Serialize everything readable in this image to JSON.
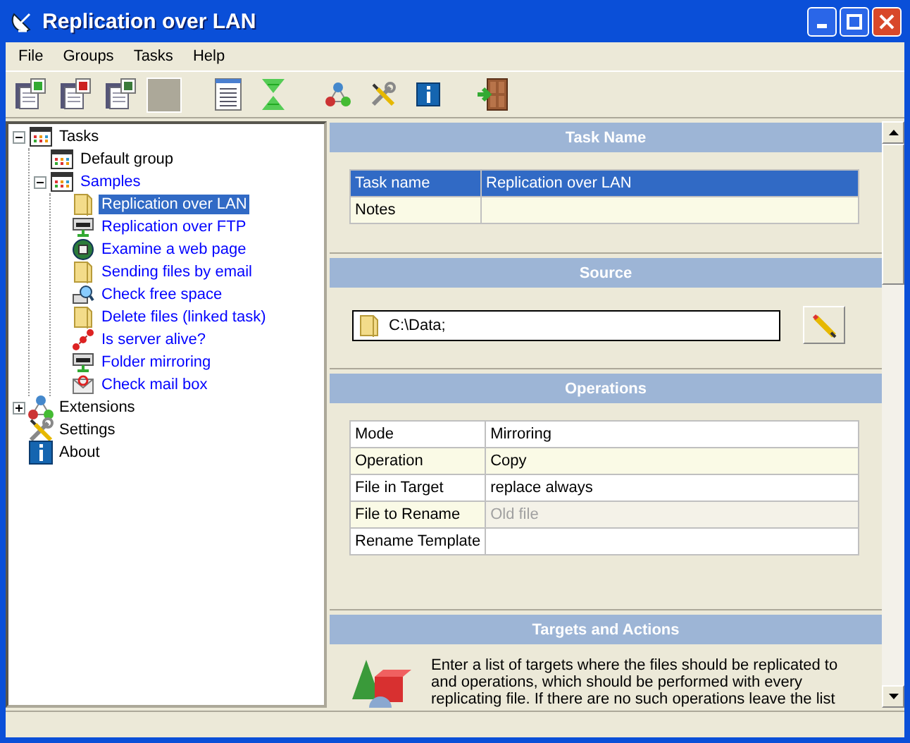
{
  "window": {
    "title": "Replication over LAN"
  },
  "menu": [
    "File",
    "Groups",
    "Tasks",
    "Help"
  ],
  "toolbar": [
    {
      "kind": "add"
    },
    {
      "kind": "remove"
    },
    {
      "kind": "props"
    },
    {
      "kind": "blank"
    },
    {
      "kind": "list"
    },
    {
      "kind": "arrows"
    },
    {
      "kind": "molecule"
    },
    {
      "kind": "tools"
    },
    {
      "kind": "info"
    },
    {
      "kind": "door"
    }
  ],
  "tree": [
    {
      "label": "Tasks",
      "kind": "group",
      "color": "#000000",
      "selected": false,
      "expanded": true,
      "children": [
        {
          "label": "Default group",
          "kind": "group",
          "color": "#000000",
          "selected": false
        },
        {
          "label": "Samples",
          "kind": "group",
          "color": "#0000ff",
          "selected": false,
          "expanded": true,
          "children": [
            {
              "label": "Replication over LAN",
              "kind": "folder",
              "selected": true
            },
            {
              "label": "Replication over FTP",
              "kind": "server",
              "color": "#0000ff",
              "selected": false
            },
            {
              "label": "Examine a web page",
              "kind": "globe",
              "color": "#0000ff",
              "selected": false
            },
            {
              "label": "Sending files by email",
              "kind": "folder",
              "color": "#0000ff",
              "selected": false
            },
            {
              "label": "Check free space",
              "kind": "magnifier",
              "color": "#0000ff",
              "selected": false
            },
            {
              "label": "Delete files (linked task)",
              "kind": "folder",
              "color": "#0000ff",
              "selected": false
            },
            {
              "label": "Is server alive?",
              "kind": "balls",
              "color": "#0000ff",
              "selected": false
            },
            {
              "label": "Folder mirroring",
              "kind": "server",
              "color": "#0000ff",
              "selected": false
            },
            {
              "label": "Check mail box",
              "kind": "envelope",
              "color": "#0000ff",
              "selected": false
            }
          ]
        }
      ]
    },
    {
      "label": "Extensions",
      "kind": "molecule",
      "color": "#000000",
      "selected": false,
      "expanded": false
    },
    {
      "label": "Settings",
      "kind": "tools",
      "color": "#000000",
      "selected": false
    },
    {
      "label": "About",
      "kind": "info",
      "color": "#000000",
      "selected": false
    }
  ],
  "sections": [
    {
      "title": "Task Name",
      "kind": "table",
      "rows": [
        {
          "label": "Task name",
          "value": "Replication over LAN",
          "selected": true
        },
        {
          "label": "Notes",
          "selected": false
        }
      ]
    },
    {
      "title": "Source",
      "kind": "path",
      "value": "C:\\Data;"
    },
    {
      "title": "Operations",
      "kind": "table",
      "rows": [
        {
          "label": "Mode",
          "value": "Mirroring",
          "selected": false,
          "disabled": false
        },
        {
          "label": "Operation",
          "value": "Copy",
          "selected": false,
          "disabled": false
        },
        {
          "label": "File in Target",
          "value": "replace always",
          "selected": false,
          "disabled": false
        },
        {
          "label": "File to Rename",
          "value": "Old file",
          "selected": false,
          "disabled": true
        },
        {
          "label": "Rename Template",
          "selected": false,
          "disabled": false
        }
      ]
    },
    {
      "title": "Targets and Actions",
      "kind": "text",
      "text": "Enter a list of targets where the files should be replicated to and operations, which should be performed with every replicating file. If there are no such operations leave the list"
    }
  ]
}
